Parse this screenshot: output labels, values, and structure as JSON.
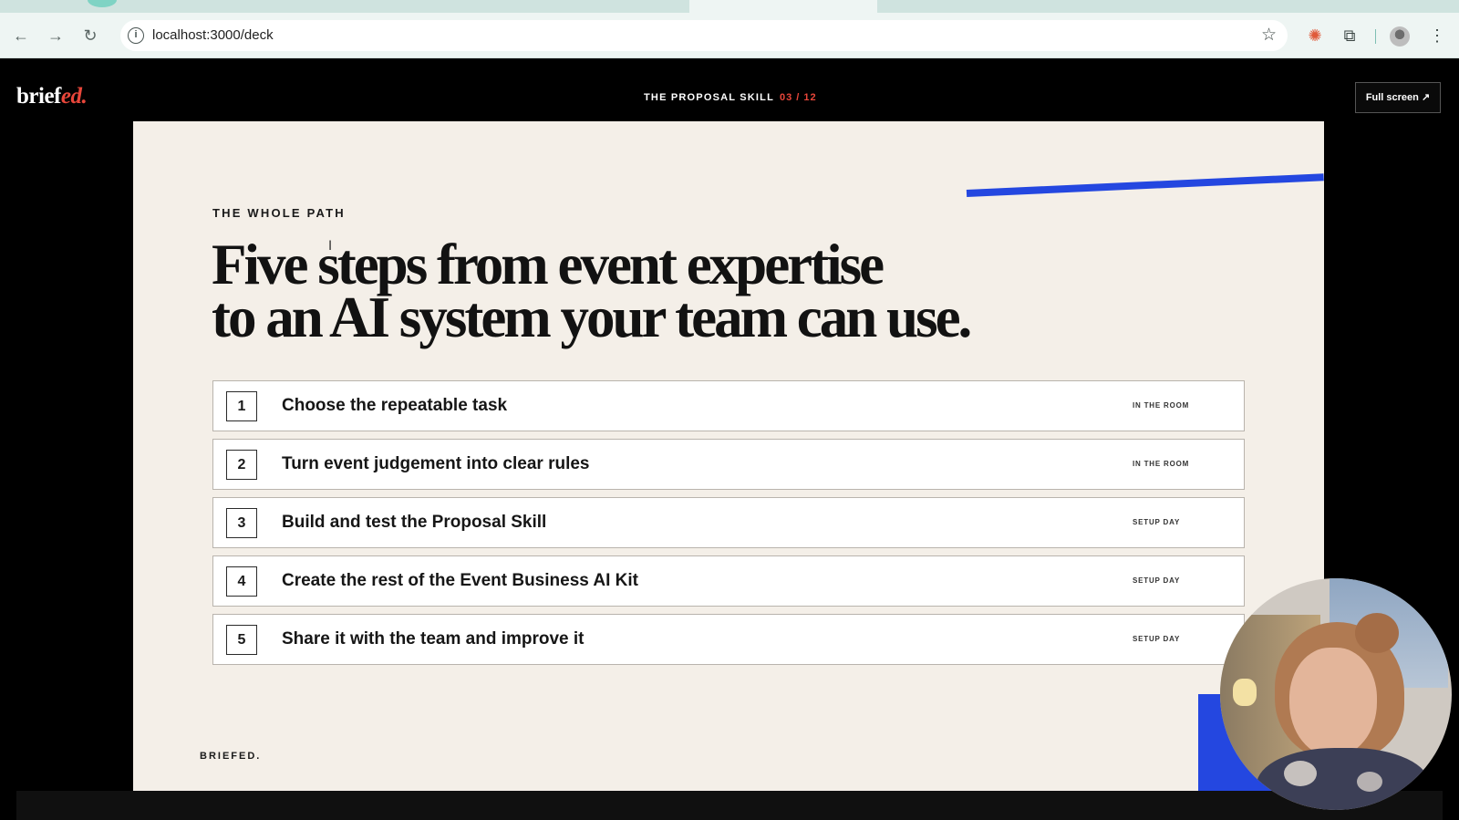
{
  "browser": {
    "url": "localhost:3000/deck",
    "icons": [
      "back-arrow-icon",
      "forward-arrow-icon",
      "reload-icon",
      "site-info-icon",
      "bookmark-star-icon",
      "extension-spark-icon",
      "extensions-puzzle-icon",
      "profile-avatar-icon",
      "more-menu-icon"
    ]
  },
  "app_header": {
    "logo_main": "brief",
    "logo_accent": "ed.",
    "deck_title": "THE PROPOSAL SKILL",
    "slide_counter": "03 / 12",
    "fullscreen_label": "Full screen ↗"
  },
  "slide": {
    "eyebrow": "THE WHOLE PATH",
    "headline_line1": "Five steps from event expertise",
    "headline_line2": "to an AI system your team can use.",
    "steps": [
      {
        "number": "1",
        "label": "Choose the repeatable task",
        "tag": "IN THE ROOM"
      },
      {
        "number": "2",
        "label": "Turn event judgement into clear rules",
        "tag": "IN THE ROOM"
      },
      {
        "number": "3",
        "label": "Build and test the Proposal Skill",
        "tag": "SETUP DAY"
      },
      {
        "number": "4",
        "label": "Create the rest of the Event Business AI Kit",
        "tag": "SETUP DAY"
      },
      {
        "number": "5",
        "label": "Share it with the team and improve it",
        "tag": "SETUP DAY"
      }
    ],
    "footer_brand": "BRIEFED.",
    "accent_color": "#2447e0",
    "brand_red": "#e8463a"
  }
}
